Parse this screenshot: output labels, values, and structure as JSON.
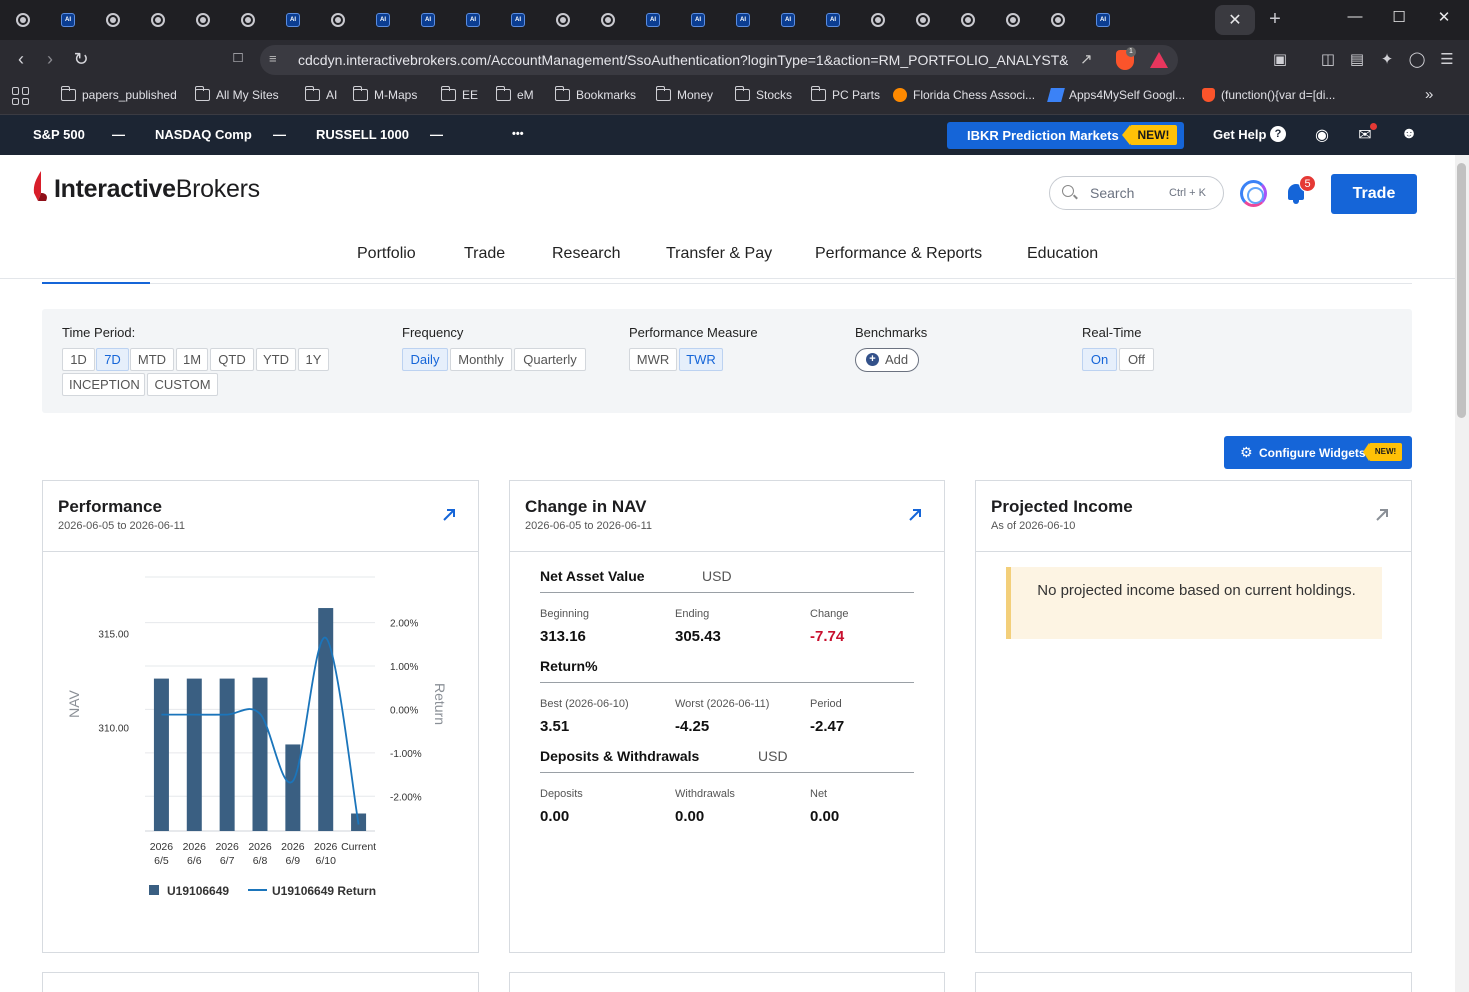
{
  "browser": {
    "active_tab_close": "✕",
    "new_tab": "+",
    "window_controls": [
      "—",
      "☐",
      "✕"
    ],
    "url": "cdcdyn.interactivebrokers.com/AccountManagement/SsoAuthentication?loginType=1&action=RM_PORTFOLIO_ANALYST&...",
    "brave_badge": "1",
    "tab_icons": [
      "globe",
      "ai",
      "globe",
      "globe",
      "globe",
      "globe",
      "ai",
      "globe",
      "ai",
      "ai",
      "ai",
      "ai",
      "globe",
      "globe",
      "ai",
      "ai",
      "ai",
      "ai",
      "ai",
      "globe",
      "globe",
      "globe",
      "globe",
      "globe",
      "ai"
    ],
    "bookmarks": [
      {
        "label": "papers_published",
        "icon": "folder-icon"
      },
      {
        "label": "All My Sites",
        "icon": "folder-icon"
      },
      {
        "label": "AI",
        "icon": "folder-icon"
      },
      {
        "label": "M-Maps",
        "icon": "folder-icon"
      },
      {
        "label": "EE",
        "icon": "folder-icon"
      },
      {
        "label": "eM",
        "icon": "folder-icon"
      },
      {
        "label": "Bookmarks",
        "icon": "folder-icon"
      },
      {
        "label": "Money",
        "icon": "folder-icon"
      },
      {
        "label": "Stocks",
        "icon": "folder-icon"
      },
      {
        "label": "PC Parts",
        "icon": "folder-icon"
      },
      {
        "label": "Florida Chess Associ...",
        "icon": "chess-icon"
      },
      {
        "label": "Apps4MySelf Googl...",
        "icon": "apps-icon"
      },
      {
        "label": "(function(){var d=[di...",
        "icon": "brave-icon"
      }
    ],
    "bookmarks_more": "»"
  },
  "ticker": {
    "items": [
      {
        "name": "S&P 500",
        "value": "—"
      },
      {
        "name": "NASDAQ Comp",
        "value": "—"
      },
      {
        "name": "RUSSELL 1000",
        "value": "—"
      }
    ],
    "more": "•••",
    "prediction_label": "IBKR Prediction Markets",
    "prediction_badge": "NEW!",
    "help_label": "Get Help",
    "help_q": "?"
  },
  "header": {
    "logo_bold": "Interactive",
    "logo_rest": "Brokers",
    "search_placeholder": "Search",
    "search_shortcut": "Ctrl + K",
    "notifications": "5",
    "trade_label": "Trade",
    "menu": [
      "Portfolio",
      "Trade",
      "Research",
      "Transfer & Pay",
      "Performance & Reports",
      "Education"
    ]
  },
  "filters": {
    "time_period": {
      "label": "Time Period:",
      "options": [
        "1D",
        "7D",
        "MTD",
        "1M",
        "QTD",
        "YTD",
        "1Y",
        "INCEPTION",
        "CUSTOM"
      ],
      "selected": "7D"
    },
    "frequency": {
      "label": "Frequency",
      "options": [
        "Daily",
        "Monthly",
        "Quarterly"
      ],
      "selected": "Daily"
    },
    "measure": {
      "label": "Performance Measure",
      "options": [
        "MWR",
        "TWR"
      ],
      "selected": "TWR"
    },
    "benchmarks": {
      "label": "Benchmarks",
      "add_label": "Add"
    },
    "realtime": {
      "label": "Real-Time",
      "options": [
        "On",
        "Off"
      ],
      "selected": "On"
    }
  },
  "configure": {
    "label": "Configure Widgets",
    "badge": "NEW!"
  },
  "performance": {
    "title": "Performance",
    "range": "2026-06-05 to 2026-06-11"
  },
  "nav": {
    "title": "Change in NAV",
    "range": "2026-06-05 to 2026-06-11",
    "nav_section": "Net Asset Value",
    "nav_currency": "USD",
    "beginning_label": "Beginning",
    "beginning": "313.16",
    "ending_label": "Ending",
    "ending": "305.43",
    "change_label": "Change",
    "change": "-7.74",
    "return_section": "Return%",
    "best_label": "Best (2026-06-10)",
    "best": "3.51",
    "worst_label": "Worst (2026-06-11)",
    "worst": "-4.25",
    "period_label": "Period",
    "period": "-2.47",
    "dw_section": "Deposits & Withdrawals",
    "dw_currency": "USD",
    "deposits_label": "Deposits",
    "deposits": "0.00",
    "withdrawals_label": "Withdrawals",
    "withdrawals": "0.00",
    "net_label": "Net",
    "net": "0.00"
  },
  "income": {
    "title": "Projected Income",
    "asof": "As of 2026-06-10",
    "message": "No projected income based on current holdings."
  },
  "colors": {
    "accent": "#1565d8",
    "bar": "#3a5f82",
    "line": "#1b75bb",
    "negative": "#c8102e",
    "notice_bg": "#fdf4e3"
  },
  "chart_data": {
    "type": "bar",
    "categories": [
      [
        "2026",
        "6/5"
      ],
      [
        "2026",
        "6/6"
      ],
      [
        "2026",
        "6/7"
      ],
      [
        "2026",
        "6/8"
      ],
      [
        "2026",
        "6/9"
      ],
      [
        "2026",
        "6/10"
      ],
      [
        "Current"
      ]
    ],
    "series": [
      {
        "name": "U19106649",
        "type": "bar",
        "axis": "left",
        "values": [
          312.6,
          312.6,
          312.6,
          312.65,
          309.1,
          316.35,
          305.43
        ]
      },
      {
        "name": "U19106649 Return",
        "type": "line",
        "axis": "right",
        "values": [
          -0.12,
          -0.12,
          -0.12,
          -0.1,
          -1.65,
          1.65,
          -2.65
        ]
      }
    ],
    "y_left": {
      "label": "NAV",
      "ticks": [
        "315.00",
        "310.00"
      ],
      "tick_values": [
        315,
        310
      ],
      "range": [
        304.5,
        318.0
      ]
    },
    "y_right": {
      "label": "Return",
      "ticks": [
        "2.00%",
        "1.00%",
        "0.00%",
        "-1.00%",
        "-2.00%"
      ],
      "tick_values": [
        2,
        1,
        0,
        -1,
        -2
      ],
      "range": [
        -2.8,
        3.05
      ]
    },
    "grid": true,
    "legend": "bottom"
  }
}
